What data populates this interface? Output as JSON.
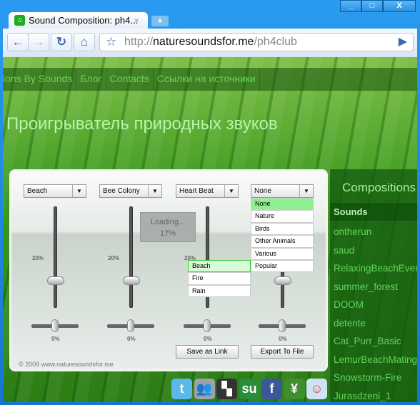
{
  "browser": {
    "tab_title": "Sound Composition: ph4...",
    "url_prefix": "http://",
    "url_domain": "naturesoundsfor.me",
    "url_path": "/ph4club",
    "window_buttons": [
      "_",
      "□",
      "X"
    ]
  },
  "nav": {
    "items": [
      "ions By Sounds",
      "Блог",
      "Contacts",
      "Ссылки на источники"
    ]
  },
  "page_title": "Проигрыватель природных звуков",
  "player": {
    "channels": [
      {
        "sound": "Beach",
        "volume_label": "20%",
        "volume": 20,
        "balance_label": "0%"
      },
      {
        "sound": "Bee Colony",
        "volume_label": "20%",
        "volume": 20,
        "balance_label": "0%"
      },
      {
        "sound": "Heart Beat",
        "volume_label": "20%",
        "volume": 20,
        "balance_label": "0%"
      },
      {
        "sound": "None",
        "volume": 20,
        "balance_label": "0%"
      }
    ],
    "loading_text": "Loading...",
    "loading_percent": "17%",
    "sound_list": [
      "Beach",
      "Fire",
      "Rain"
    ],
    "category_list": [
      "None",
      "Nature",
      "Birds",
      "Other Animals",
      "Various",
      "Popular"
    ],
    "save_label": "Save as Link",
    "export_label": "Export To File",
    "copyright": "© 2009 www.naturesoundsfor.me"
  },
  "sidebar": {
    "title": "Compositions",
    "header": "Sounds",
    "items": [
      "ontherun",
      "saud",
      "RelaxingBeachEvening",
      "summer_forest",
      "DOOM",
      "detente",
      "Cat_Purr_Basic",
      "LemurBeachMating",
      "Snowstorm-Fire",
      "Jurasdzeni_1"
    ]
  },
  "social": [
    "twitter-icon",
    "myspace-icon",
    "delicious-icon",
    "stumbleupon-icon",
    "facebook-icon",
    "newsvine-icon",
    "reddit-icon"
  ],
  "colors": {
    "accent": "#5fd65a",
    "selected": "#8ff08f"
  }
}
